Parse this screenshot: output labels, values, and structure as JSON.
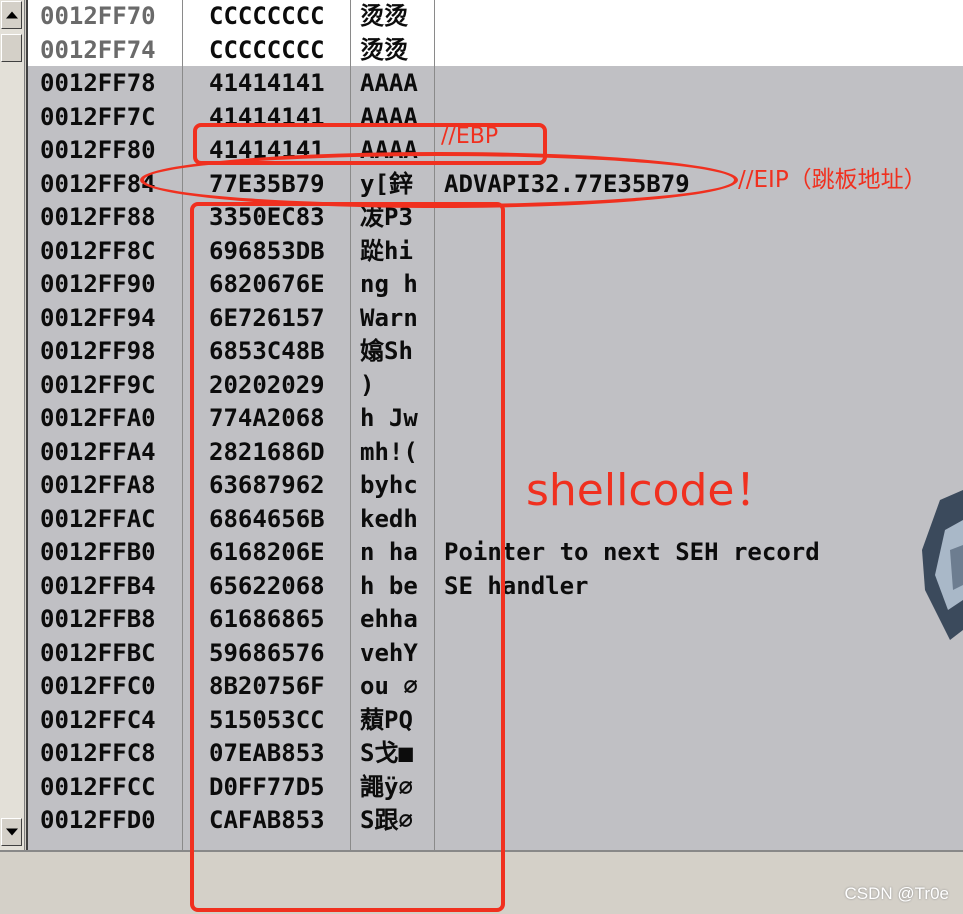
{
  "rows": [
    {
      "addr": "0012FF70",
      "val": "CCCCCCCC",
      "ascii": "烫烫",
      "comment": ""
    },
    {
      "addr": "0012FF74",
      "val": "CCCCCCCC",
      "ascii": "烫烫",
      "comment": ""
    },
    {
      "addr": "0012FF78",
      "val": "41414141",
      "ascii": "AAAA",
      "comment": ""
    },
    {
      "addr": "0012FF7C",
      "val": "41414141",
      "ascii": "AAAA",
      "comment": ""
    },
    {
      "addr": "0012FF80",
      "val": "41414141",
      "ascii": "AAAA",
      "comment": ""
    },
    {
      "addr": "0012FF84",
      "val": "77E35B79",
      "ascii": "y[鋅",
      "comment": "ADVAPI32.77E35B79"
    },
    {
      "addr": "0012FF88",
      "val": "3350EC83",
      "ascii": "冹P3",
      "comment": ""
    },
    {
      "addr": "0012FF8C",
      "val": "696853DB",
      "ascii": "踨hi",
      "comment": ""
    },
    {
      "addr": "0012FF90",
      "val": "6820676E",
      "ascii": "ng h",
      "comment": ""
    },
    {
      "addr": "0012FF94",
      "val": "6E726157",
      "ascii": "Warn",
      "comment": ""
    },
    {
      "addr": "0012FF98",
      "val": "6853C48B",
      "ascii": "嬆Sh",
      "comment": ""
    },
    {
      "addr": "0012FF9C",
      "val": "20202029",
      "ascii": ")",
      "comment": ""
    },
    {
      "addr": "0012FFA0",
      "val": "774A2068",
      "ascii": "h Jw",
      "comment": ""
    },
    {
      "addr": "0012FFA4",
      "val": "2821686D",
      "ascii": "mh!(",
      "comment": ""
    },
    {
      "addr": "0012FFA8",
      "val": "63687962",
      "ascii": "byhc",
      "comment": ""
    },
    {
      "addr": "0012FFAC",
      "val": "6864656B",
      "ascii": "kedh",
      "comment": ""
    },
    {
      "addr": "0012FFB0",
      "val": "6168206E",
      "ascii": "n ha",
      "comment": "Pointer to next SEH record"
    },
    {
      "addr": "0012FFB4",
      "val": "65622068",
      "ascii": "h be",
      "comment": "SE handler"
    },
    {
      "addr": "0012FFB8",
      "val": "61686865",
      "ascii": "ehha",
      "comment": ""
    },
    {
      "addr": "0012FFBC",
      "val": "59686576",
      "ascii": "vehY",
      "comment": ""
    },
    {
      "addr": "0012FFC0",
      "val": "8B20756F",
      "ascii": "ou ∅",
      "comment": ""
    },
    {
      "addr": "0012FFC4",
      "val": "515053CC",
      "ascii": "蘈PQ",
      "comment": ""
    },
    {
      "addr": "0012FFC8",
      "val": "07EAB853",
      "ascii": "S戈■",
      "comment": ""
    },
    {
      "addr": "0012FFCC",
      "val": "D0FF77D5",
      "ascii": "譝ÿ∅",
      "comment": ""
    },
    {
      "addr": "0012FFD0",
      "val": "CAFAB853",
      "ascii": "S跟∅",
      "comment": ""
    }
  ],
  "annotations": {
    "ebp": "//EBP",
    "eip": "//EIP（跳板地址）",
    "shellcode": "shellcode！"
  },
  "watermark": "CSDN @Tr0e",
  "colors": {
    "annotation": "#f0301f",
    "stack_bg": "#c0c0c4"
  }
}
